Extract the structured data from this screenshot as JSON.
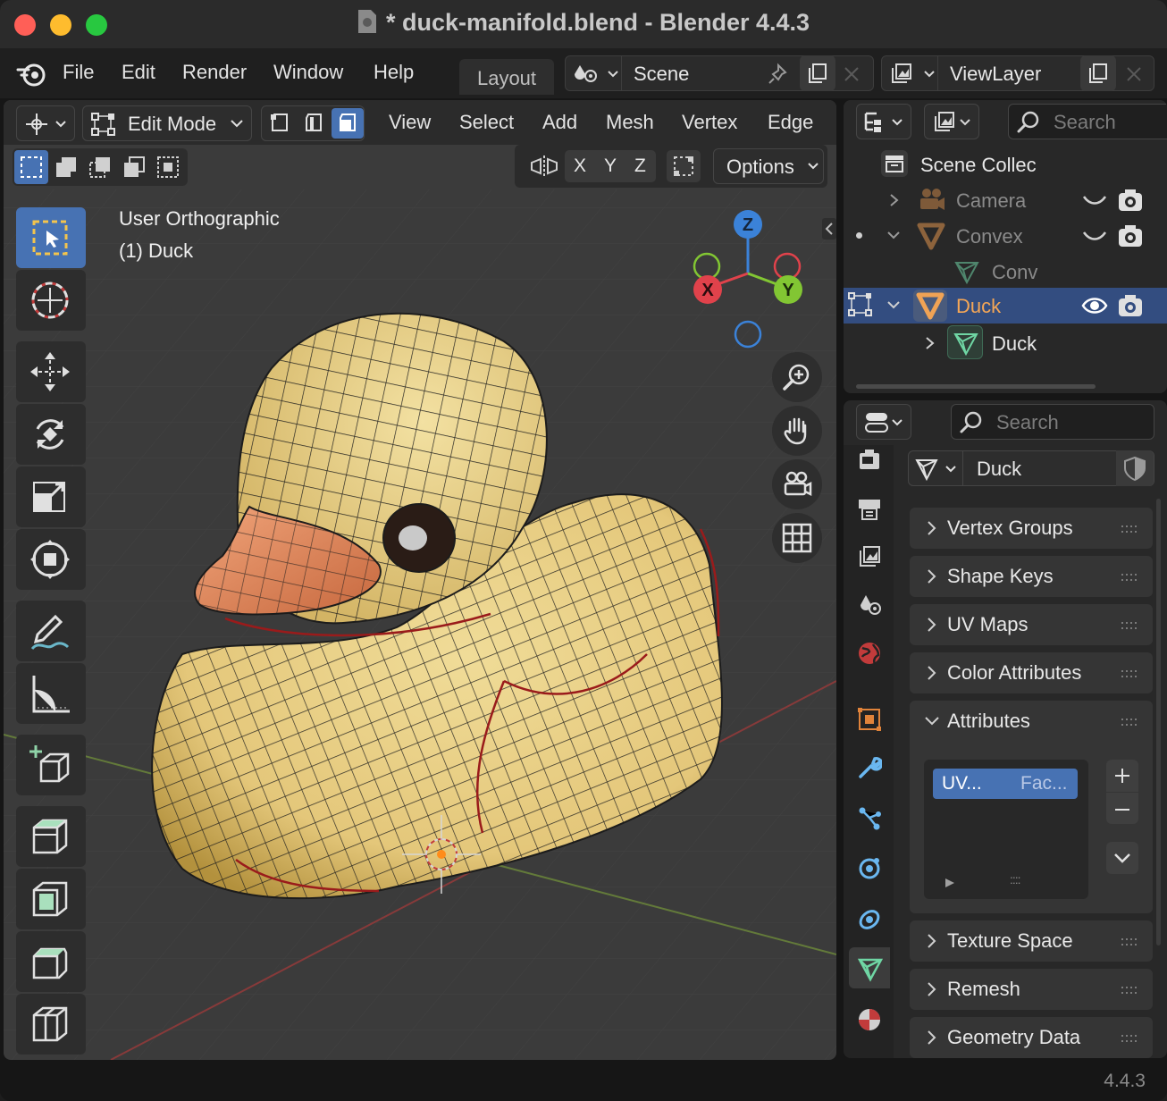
{
  "window": {
    "title": "* duck-manifold.blend - Blender 4.4.3",
    "traffic_lights": [
      "#ff5f57",
      "#febc2e",
      "#28c840"
    ]
  },
  "menu": {
    "items": [
      "File",
      "Edit",
      "Render",
      "Window",
      "Help"
    ],
    "workspace_tab": "Layout",
    "scene": "Scene",
    "view_layer": "ViewLayer"
  },
  "viewport": {
    "mode": "Edit Mode",
    "menus": [
      "View",
      "Select",
      "Add",
      "Mesh",
      "Vertex",
      "Edge"
    ],
    "axes": [
      "X",
      "Y",
      "Z"
    ],
    "options_label": "Options",
    "view_name": "User Orthographic",
    "active_object": "(1) Duck",
    "gizmo": {
      "x": "X",
      "y": "Y",
      "z": "Z",
      "x_color": "#e0424b",
      "y_color": "#82c633",
      "z_color": "#3b82d8"
    },
    "tools": [
      "select-box",
      "cursor",
      "move",
      "rotate",
      "scale",
      "transform",
      "annotate",
      "measure",
      "add-cube",
      "extrude",
      "inset",
      "bevel",
      "loop-cut"
    ],
    "mesh_color": "#e8cf86",
    "beak_color": "#e9936a"
  },
  "outliner": {
    "search_placeholder": "Search",
    "rows": [
      {
        "label": "Scene Collec",
        "type": "collection"
      },
      {
        "label": "Camera",
        "type": "camera"
      },
      {
        "label": "Convex",
        "type": "mesh-object"
      },
      {
        "label": "Conv",
        "type": "mesh-data"
      },
      {
        "label": "Duck",
        "type": "mesh-object",
        "selected": true
      },
      {
        "label": "Duck",
        "type": "mesh-data"
      }
    ]
  },
  "properties": {
    "search_placeholder": "Search",
    "datablock": "Duck",
    "panels": [
      {
        "label": "Vertex Groups",
        "open": false
      },
      {
        "label": "Shape Keys",
        "open": false
      },
      {
        "label": "UV Maps",
        "open": false
      },
      {
        "label": "Color Attributes",
        "open": false
      },
      {
        "label": "Attributes",
        "open": true
      },
      {
        "label": "Texture Space",
        "open": false
      },
      {
        "label": "Remesh",
        "open": false
      },
      {
        "label": "Geometry Data",
        "open": false
      }
    ],
    "attribute_item": {
      "name": "UV...",
      "domain": "Fac..."
    },
    "list_grip": "::::",
    "accent": "#4772b3"
  },
  "status": {
    "version": "4.4.3"
  }
}
